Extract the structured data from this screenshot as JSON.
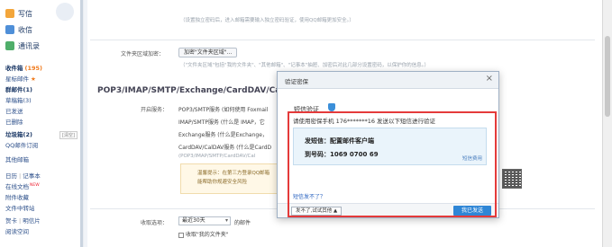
{
  "sidebar": {
    "buttons": [
      {
        "label": "写信",
        "icon": "write-icon"
      },
      {
        "label": "收信",
        "icon": "inbox-icon"
      },
      {
        "label": "通讯录",
        "icon": "contacts-icon"
      }
    ],
    "items": [
      {
        "label": "收件箱",
        "badge": "(195)"
      },
      {
        "label": "星标邮件",
        "badge": "★"
      },
      {
        "label": "群邮件",
        "badge": "(1)"
      },
      {
        "label": "草稿箱",
        "badge": "(3)"
      },
      {
        "label": "已发送",
        "badge": ""
      },
      {
        "label": "已删除",
        "badge": ""
      },
      {
        "label": "垃圾箱",
        "badge": "(2)"
      },
      {
        "label": "QQ邮件订阅",
        "badge": ""
      },
      {
        "label": "其他邮箱",
        "badge": ""
      },
      {
        "label": "日历",
        "extra": "记事本"
      },
      {
        "label": "在线文档",
        "new": "NEW"
      },
      {
        "label": "附件收藏"
      },
      {
        "label": "文件中转站"
      },
      {
        "label": "贺卡",
        "extra": "明信片"
      },
      {
        "label": "阅读空间"
      }
    ],
    "clear_tag": "[清空]"
  },
  "settings": {
    "top_hint": "（设置独立密码后，进入邮箱需要输入独立密码验证，使用QQ邮箱更加安全。）",
    "file_label": "文件夹区域加密：",
    "file_button": "加密\"文件夹区域\"...",
    "file_hint": "（\"文件夹区域\"包括\"我的文件夹\"、\"其他邮箱\"、\"记事本\"抽屉、加密后对此几部分设置密码，以保护你的信息。）",
    "section_title": "POP3/IMAP/SMTP/Exchange/CardDAV/CalDAV服务",
    "open_label": "开启服务：",
    "svc": [
      "POP3/SMTP服务 (如何使用 Foxmail",
      "IMAP/SMTP服务 (什么是 IMAP，它",
      "Exchange服务 (什么是Exchange，",
      "CardDAV/CalDAV服务 (什么是CardD",
      "(POP3/IMAP/SMTP/CardDAV/Cal"
    ],
    "tip_line1": "温馨提示：在第三方登录QQ邮箱",
    "tip_line2": "能帮助你规避安全风险",
    "recv_label": "收取选项：",
    "recv_select": "最近30天",
    "recv_suffix": "的邮件",
    "recv_check": "收取\"我的文件夹\""
  },
  "dialog": {
    "title": "验证密保",
    "close": "×",
    "subtitle": "短信验证",
    "line": "请使用密保手机 176*******16 发送以下短信进行验证",
    "send_label": "发短信：配置邮件客户端",
    "to_label": "到号码：1069 0700 69",
    "fee_link": "短信费用",
    "help_link": "短信发不了？",
    "cant_send": "发不了,试试其他 ▲",
    "sent_button": "我已发送"
  }
}
